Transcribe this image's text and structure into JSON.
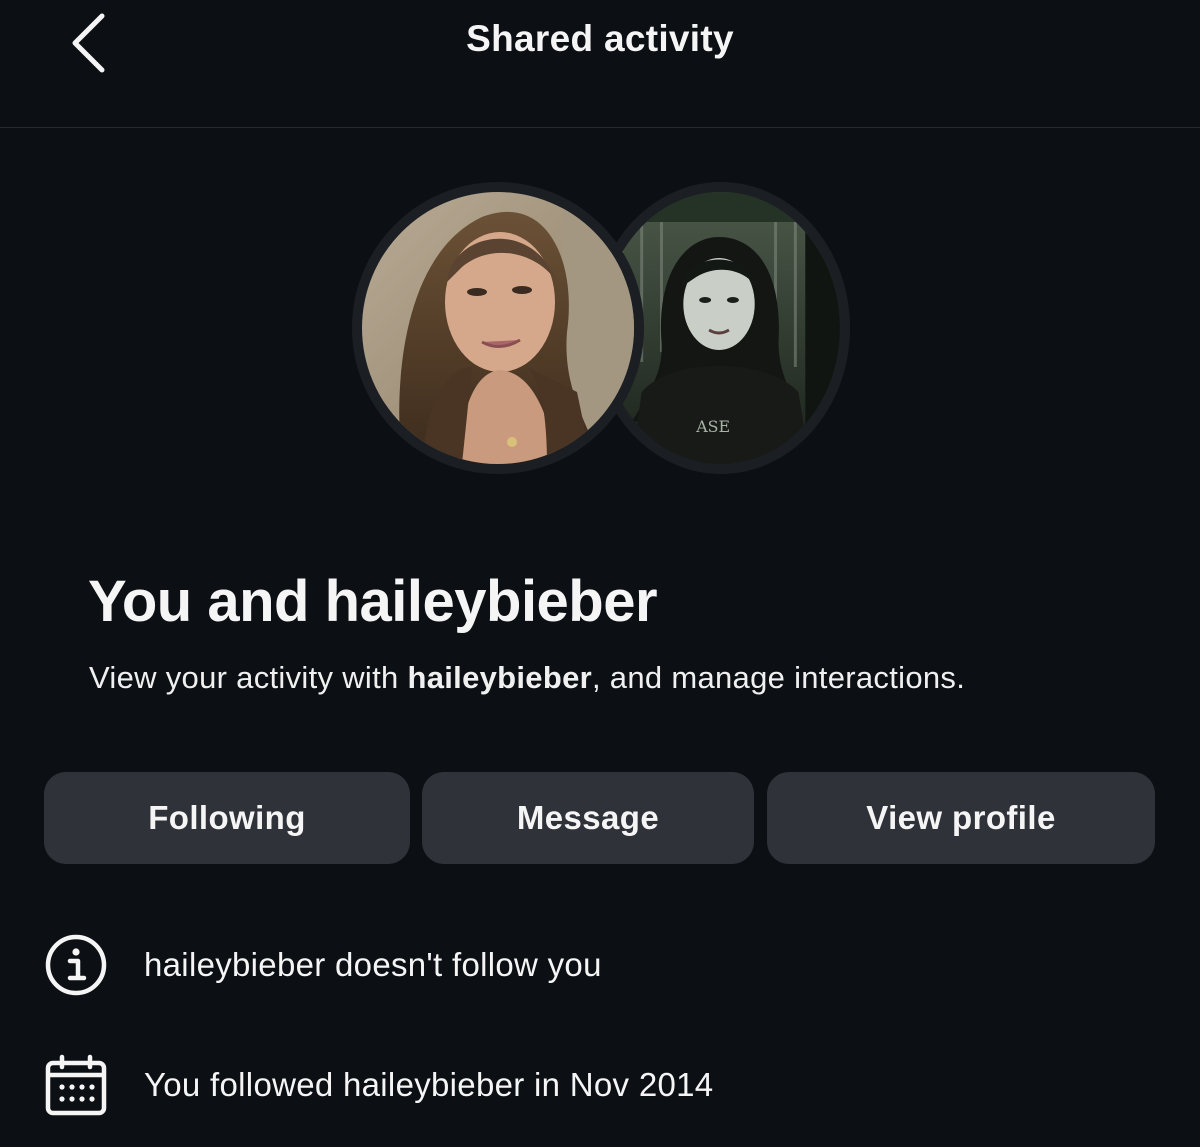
{
  "header": {
    "title": "Shared activity"
  },
  "avatars": {
    "mine_icon": "profile-photo",
    "other_icon": "profile-photo"
  },
  "main": {
    "title": "You and haileybieber",
    "subtitle_prefix": "View your activity with ",
    "subtitle_username": "haileybieber",
    "subtitle_suffix": ", and manage interactions."
  },
  "actions": {
    "following_label": "Following",
    "message_label": "Message",
    "view_profile_label": "View profile"
  },
  "info": {
    "follow_status": "haileybieber doesn't follow you",
    "follow_status_icon": "info-icon",
    "followed_since": "You followed haileybieber in Nov 2014",
    "followed_since_icon": "calendar-icon"
  },
  "colors": {
    "background": "#0c1014",
    "button_background": "#2f3339",
    "text": "#f5f5f5",
    "divider": "#262a2f"
  }
}
